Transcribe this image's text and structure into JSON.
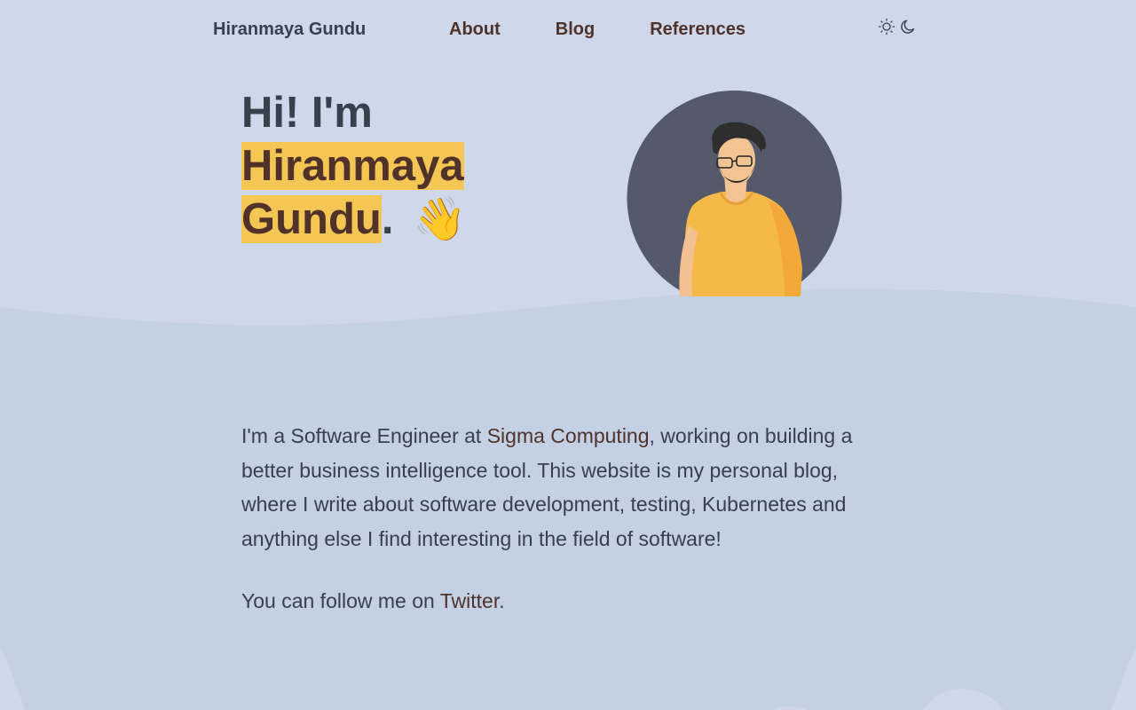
{
  "header": {
    "site_title": "Hiranmaya Gundu",
    "nav": [
      {
        "label": "About"
      },
      {
        "label": "Blog"
      },
      {
        "label": "References"
      }
    ],
    "theme_icons": [
      "sun-icon",
      "moon-icon"
    ]
  },
  "hero": {
    "greeting": "Hi! I'm",
    "first_name": "Hiranmaya",
    "last_name": "Gundu",
    "period": ".",
    "emoji": "👋"
  },
  "bio": {
    "p1_before": "I'm a Software Engineer at ",
    "p1_link": "Sigma Computing",
    "p1_after": ", working on building a better business intelligence tool. This website is my personal blog, where I write about software development, testing, Kubernetes and anything else I find interesting in the field of software!",
    "p2_before": "You can follow me on ",
    "p2_link": "Twitter",
    "p2_after": "."
  },
  "colors": {
    "background": "#cfd8ea",
    "lower_band": "#c4d0e3",
    "accent_highlight": "#f4c653",
    "link": "#50322a",
    "text": "#37404d",
    "avatar_bg": "#555a6b"
  }
}
